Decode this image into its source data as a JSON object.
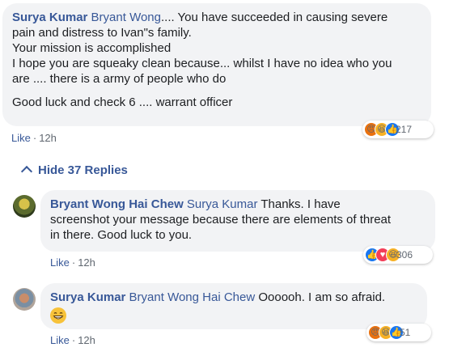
{
  "comments": [
    {
      "author": "Surya Kumar",
      "tag": "Bryant Wong",
      "text1": ".... You have succeeded in causing severe",
      "line2": "pain and distress to Ivan\"s family.",
      "line3": "Your mission is accomplished",
      "line4": "I hope you are squeaky clean because... whilst I have no idea who you",
      "line5": "are .... there is a army of people who do",
      "line6": "Good luck and check 6 .... warrant officer",
      "like_label": "Like",
      "time": "12h",
      "reaction_count": "217"
    },
    {
      "author": "Bryant Wong Hai Chew",
      "tag": "Surya Kumar",
      "text1": " Thanks. I have",
      "line2": "screenshot your message because there are elements of threat",
      "line3": "in there. Good luck to you.",
      "like_label": "Like",
      "time": "12h",
      "reaction_count": "306"
    },
    {
      "author": "Surya Kumar",
      "tag": "Bryant Wong Hai Chew",
      "text1": " Oooooh. I am so afraid.",
      "like_label": "Like",
      "time": "12h",
      "reaction_count": "51"
    }
  ],
  "hide_replies": "Hide 37 Replies",
  "colors": {
    "link": "#385898",
    "bubble": "#f2f3f5",
    "meta": "#606770"
  },
  "icons": [
    "angry-icon",
    "haha-icon",
    "like-icon",
    "love-icon",
    "chevron-up-icon",
    "grin-emoji-icon"
  ]
}
